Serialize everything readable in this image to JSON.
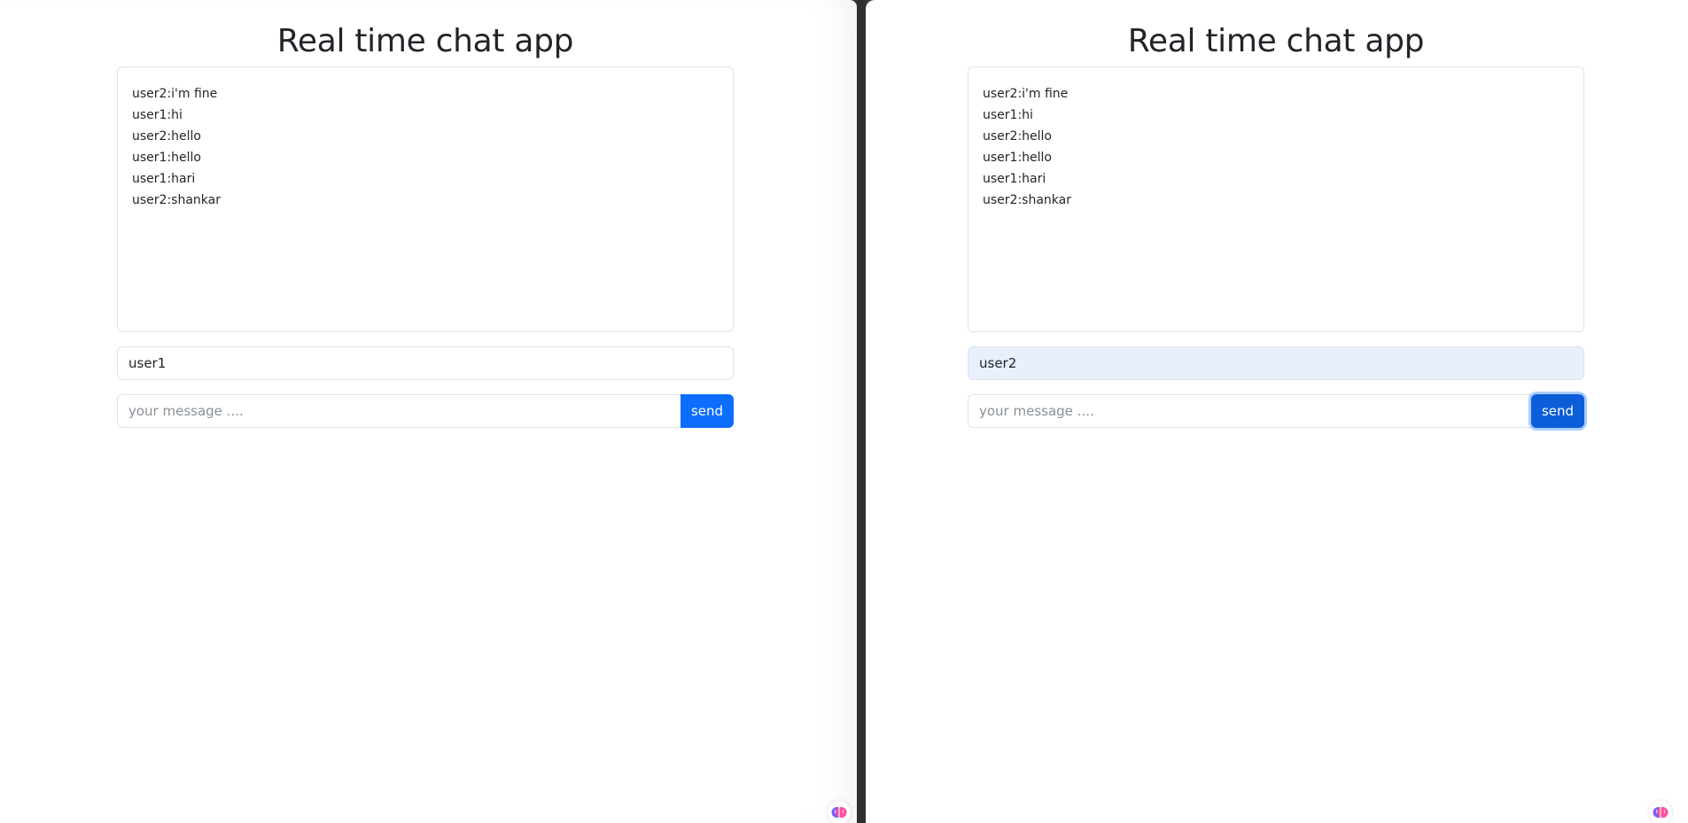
{
  "colors": {
    "primary": "#0d6efd",
    "primary_focused": "#0b5ed7",
    "autofill_bg": "#e8f0fe",
    "text": "#212529",
    "border": "#dee2e6"
  },
  "left_window": {
    "title": "Real time chat app",
    "messages": [
      "user2:i'm fine",
      "user1:hi",
      "user2:hello",
      "user1:hello",
      "user1:hari",
      "user2:shankar"
    ],
    "username_value": "user1",
    "message_placeholder": "your message ....",
    "send_label": "send",
    "extension_icon": "brain-icon"
  },
  "right_window": {
    "title": "Real time chat app",
    "messages": [
      "user2:i'm fine",
      "user1:hi",
      "user2:hello",
      "user1:hello",
      "user1:hari",
      "user2:shankar"
    ],
    "username_value": "user2",
    "message_placeholder": "your message ....",
    "send_label": "send",
    "extension_icon": "brain-icon"
  }
}
